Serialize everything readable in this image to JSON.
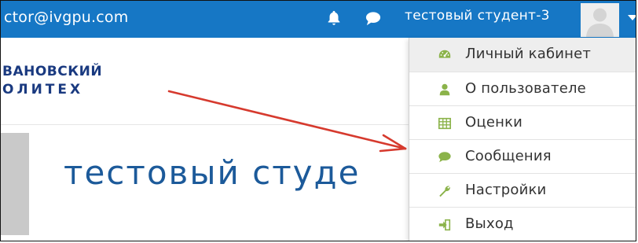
{
  "topbar": {
    "email": "ctor@ivgpu.com",
    "username": "тестовый студент-3",
    "bg_color": "#1677c5"
  },
  "logo": {
    "line1": "ВАНОВСКИЙ",
    "line2": "ОЛИТЕХ"
  },
  "profile": {
    "name": "тестовый студе"
  },
  "menu": {
    "items": [
      {
        "label": "Личный кабинет",
        "icon": "dashboard-icon",
        "color": "#8bb34a"
      },
      {
        "label": "О пользователе",
        "icon": "user-icon",
        "color": "#8bb34a"
      },
      {
        "label": "Оценки",
        "icon": "table-icon",
        "color": "#8bb34a"
      },
      {
        "label": "Сообщения",
        "icon": "comment-icon",
        "color": "#8bb34a"
      },
      {
        "label": "Настройки",
        "icon": "wrench-icon",
        "color": "#8bb34a"
      },
      {
        "label": "Выход",
        "icon": "sign-out-icon",
        "color": "#8bb34a"
      }
    ]
  },
  "annotation": {
    "arrow_color": "#d63a2e"
  }
}
